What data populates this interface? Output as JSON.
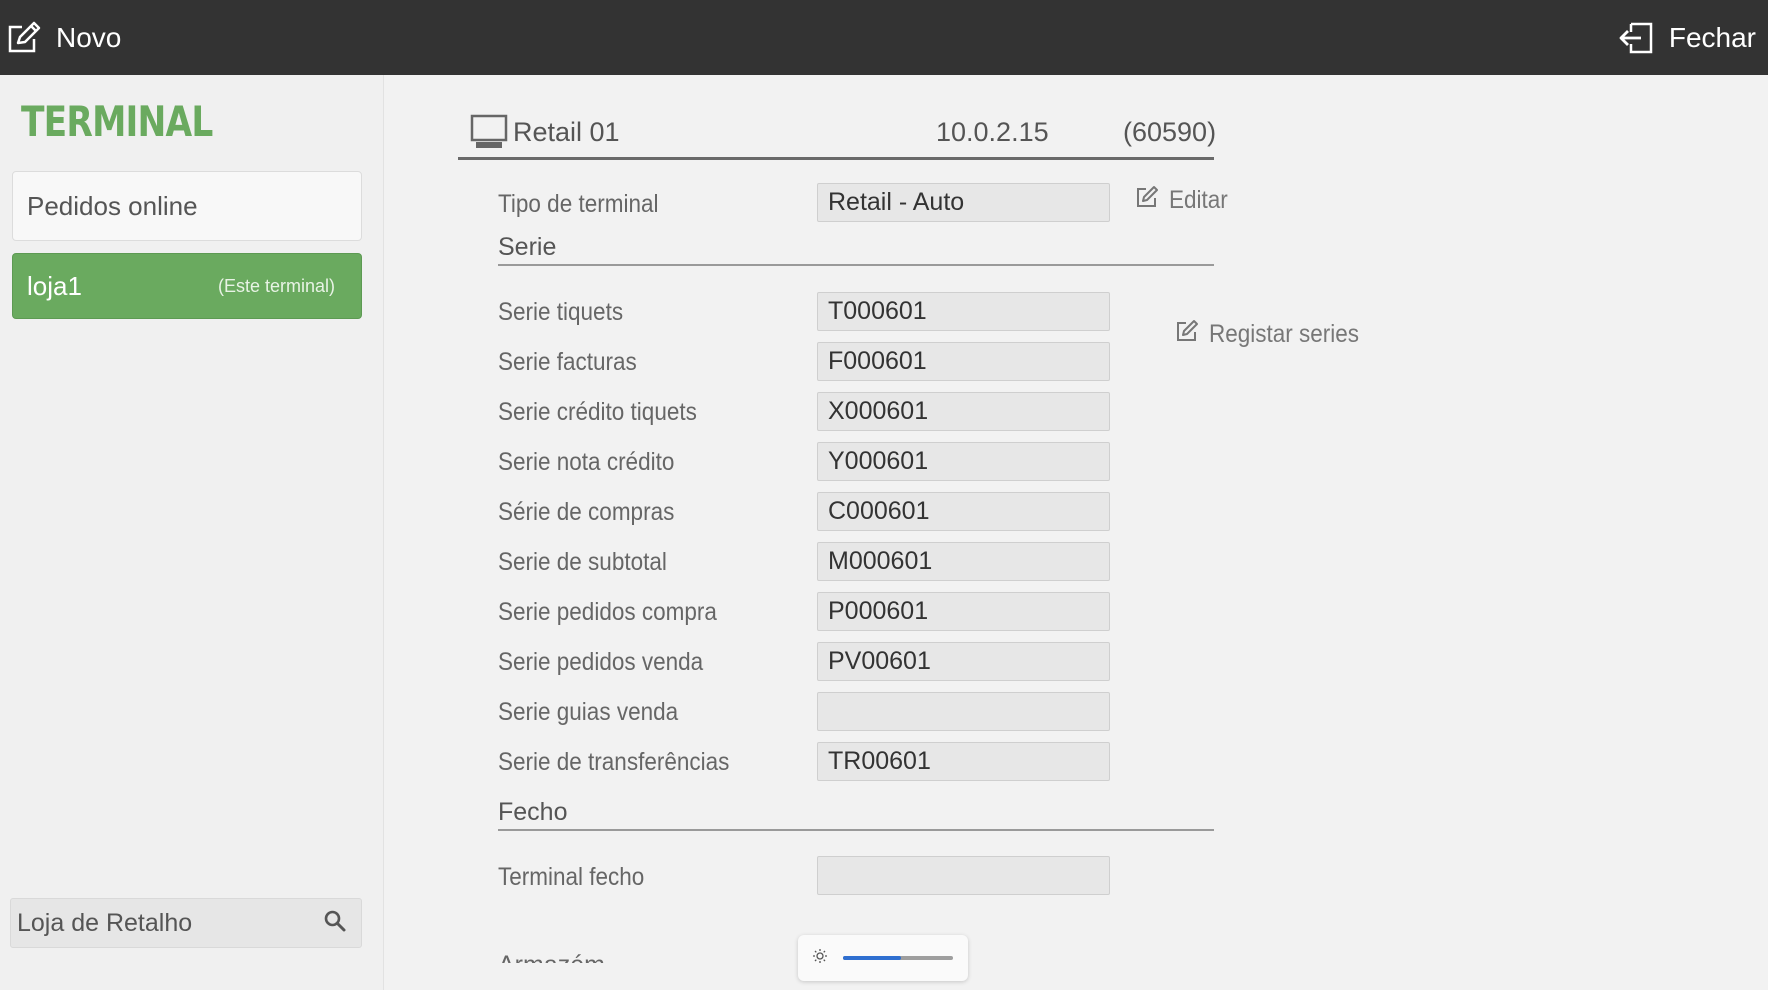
{
  "topbar": {
    "new_label": "Novo",
    "close_label": "Fechar"
  },
  "sidebar": {
    "title": "TERMINAL",
    "items": [
      {
        "label": "Pedidos online"
      },
      {
        "label": "loja1",
        "sublabel": "(Este terminal)",
        "active": true
      }
    ],
    "search_value": "Loja de Retalho"
  },
  "header": {
    "name": "Retail 01",
    "ip": "10.0.2.15",
    "port": "(60590)"
  },
  "terminal_type": {
    "label": "Tipo de terminal",
    "value": "Retail - Auto",
    "edit_label": "Editar"
  },
  "serie": {
    "title": "Serie",
    "register_label": "Registar series",
    "fields": [
      {
        "label": "Serie tiquets",
        "value": "T000601"
      },
      {
        "label": "Serie facturas",
        "value": "F000601"
      },
      {
        "label": "Serie crédito tiquets",
        "value": "X000601"
      },
      {
        "label": "Serie nota crédito",
        "value": "Y000601"
      },
      {
        "label": "Série de compras",
        "value": "C000601"
      },
      {
        "label": "Serie de subtotal",
        "value": "M000601"
      },
      {
        "label": "Serie pedidos compra",
        "value": "P000601"
      },
      {
        "label": "Serie pedidos venda",
        "value": "PV00601"
      },
      {
        "label": "Serie guias venda",
        "value": ""
      },
      {
        "label": "Serie de transferências",
        "value": "TR00601"
      }
    ]
  },
  "fecho": {
    "title": "Fecho",
    "fields": [
      {
        "label": "Terminal fecho",
        "value": ""
      }
    ]
  },
  "cutoff_section": "Armazém",
  "brightness": {
    "level": 0.53,
    "accent": "#2f6fd0"
  },
  "colors": {
    "topbar": "#333333",
    "accent_green": "#6aaa5f"
  }
}
